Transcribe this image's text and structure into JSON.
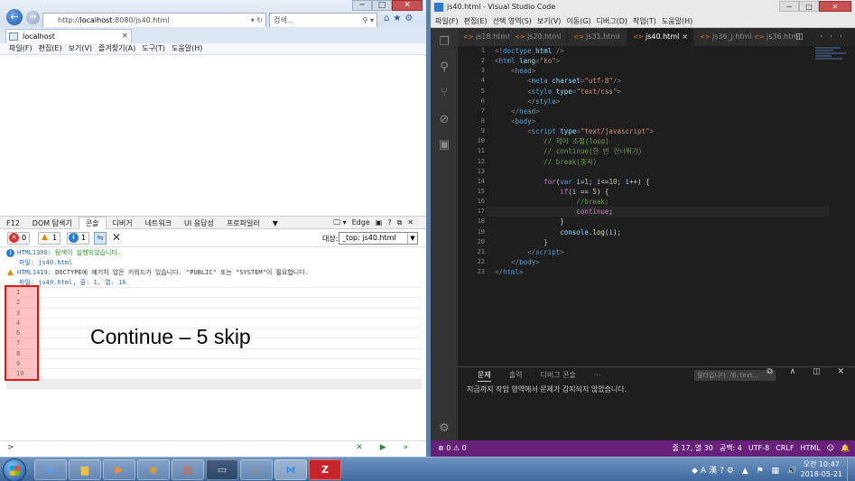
{
  "ie": {
    "address_prefix": "http://",
    "address_host": "localhost",
    "address_rest": ":8080/js40.html",
    "address_icons": "▾ ↻",
    "search_placeholder": "검색...",
    "search_icon": "⚲ ▾",
    "tab_title": "localhost",
    "tab_close": "×",
    "menu": [
      "파일(F)",
      "편집(E)",
      "보기(V)",
      "즐겨찾기(A)",
      "도구(T)",
      "도움말(H)"
    ],
    "toolbar_icons": "⌂★⚙",
    "win_min": "─",
    "win_max": "□",
    "win_close": "✕"
  },
  "devtools": {
    "tabs": [
      "F12",
      "DOM 탐색기",
      "콘솔",
      "디버거",
      "네트워크",
      "UI 응답성",
      "프로파일러",
      "▼"
    ],
    "active_tab": "콘솔",
    "right_controls": [
      "🖵 ▾",
      "Edge",
      "▣",
      "?",
      "⧉",
      "✕"
    ],
    "counts": {
      "errors": "0",
      "warnings": "1",
      "info": "1"
    },
    "target_label": "대상:",
    "target_value": "_top: js40.html",
    "messages": [
      {
        "type": "info",
        "code": "HTML1300:",
        "text": " 탐색이 실행되었습니다.",
        "sub": "파일: js40.html"
      },
      {
        "type": "warning",
        "code": "HTML1419:",
        "text": " DOCTYPE에 예기치 않은 키워드가 있습니다. \"PUBLIC\" 또는 \"SYSTEM\"이 필요합니다.",
        "sub": "파일: js40.html, 줄: 1, 열: 16"
      }
    ],
    "log_values": [
      "1",
      "2",
      "3",
      "4",
      "6",
      "7",
      "8",
      "9",
      "10",
      ""
    ],
    "prompt": ">",
    "run_icons": "✕ ▶ »"
  },
  "annotation": "Continue – 5 skip",
  "vscode": {
    "title": "js40.html - Visual Studio Code",
    "menu": [
      "파일(F)",
      "편집(E)",
      "선택 영역(S)",
      "보기(V)",
      "이동(G)",
      "디버그(D)",
      "작업(T)",
      "도움말(H)"
    ],
    "tabs": [
      "js18.html",
      "js20.html",
      "js31.html",
      "js40.html",
      "js36_j.html",
      "js36.html"
    ],
    "active_tab": "js40.html",
    "tab_close": "×",
    "tab_actions": "◫ ···",
    "panel_tabs": [
      "문제",
      "출력",
      "디버그 콘솔",
      "···"
    ],
    "panel_active": "문제",
    "panel_filter": "필터입니다. 예: text...",
    "panel_icons": "⧉ ∧ ◫ ✕",
    "panel_message": "지금까지 작업 영역에서 문제가 감지되지 않았습니다.",
    "status_left": "⊗ 0 ⚠ 0",
    "status_right": [
      "줄 17, 열 30",
      "공백: 4",
      "UTF-8",
      "CRLF",
      "HTML",
      "☺",
      "🔔"
    ],
    "win_min": "─",
    "win_max": "□",
    "win_close": "✕",
    "activity_icons": [
      "files-icon",
      "search-icon",
      "git-icon",
      "debug-icon",
      "extensions-icon",
      "settings-icon"
    ],
    "code_lines": [
      [
        [
          "d",
          "<!"
        ],
        [
          "t",
          "doctype"
        ],
        [
          "a",
          " html"
        ],
        [
          "d",
          " />"
        ]
      ],
      [
        [
          "d",
          "<"
        ],
        [
          "t",
          "html"
        ],
        [
          "a",
          " lang"
        ],
        [
          "d",
          "="
        ],
        [
          "s",
          "\"ko\""
        ],
        [
          "d",
          ">"
        ]
      ],
      [
        [
          "d",
          "    <"
        ],
        [
          "t",
          "head"
        ],
        [
          "d",
          ">"
        ]
      ],
      [
        [
          "d",
          "        <"
        ],
        [
          "t",
          "meta"
        ],
        [
          "a",
          " charset"
        ],
        [
          "d",
          "="
        ],
        [
          "s",
          "\"utf-8\""
        ],
        [
          "d",
          "/>"
        ]
      ],
      [
        [
          "d",
          "        <"
        ],
        [
          "t",
          "style"
        ],
        [
          "a",
          " type"
        ],
        [
          "d",
          "="
        ],
        [
          "s",
          "\"text/css\""
        ],
        [
          "d",
          ">"
        ]
      ],
      [
        [
          "d",
          "        </"
        ],
        [
          "t",
          "style"
        ],
        [
          "d",
          ">"
        ]
      ],
      [
        [
          "d",
          "    </"
        ],
        [
          "t",
          "head"
        ],
        [
          "d",
          ">"
        ]
      ],
      [
        [
          "d",
          "    <"
        ],
        [
          "t",
          "body"
        ],
        [
          "d",
          ">"
        ]
      ],
      [
        [
          "d",
          "        <"
        ],
        [
          "t",
          "script"
        ],
        [
          "a",
          " type"
        ],
        [
          "d",
          "="
        ],
        [
          "s",
          "\"text/javascript\""
        ],
        [
          "d",
          ">"
        ]
      ],
      [
        [
          "c",
          "            // 제어 조절(loop)"
        ]
      ],
      [
        [
          "c",
          "            // continue(한 번 건너뛰기)"
        ]
      ],
      [
        [
          "c",
          "            // break(중지)"
        ]
      ],
      [
        [
          "p",
          ""
        ]
      ],
      [
        [
          "k",
          "            for"
        ],
        [
          "p",
          "("
        ],
        [
          "t",
          "var"
        ],
        [
          "a",
          " i"
        ],
        [
          "p",
          "="
        ],
        [
          "n",
          "1"
        ],
        [
          "p",
          "; "
        ],
        [
          "a",
          "i"
        ],
        [
          "p",
          "<="
        ],
        [
          "n",
          "10"
        ],
        [
          "p",
          "; "
        ],
        [
          "a",
          "i"
        ],
        [
          "p",
          "++) {"
        ]
      ],
      [
        [
          "k",
          "                if"
        ],
        [
          "p",
          "("
        ],
        [
          "a",
          "i"
        ],
        [
          "p",
          " == "
        ],
        [
          "n",
          "5"
        ],
        [
          "p",
          ") {"
        ]
      ],
      [
        [
          "c",
          "                    //break;"
        ]
      ],
      [
        [
          "k",
          "                    continue"
        ],
        [
          "p",
          ";"
        ]
      ],
      [
        [
          "p",
          "                }"
        ]
      ],
      [
        [
          "a",
          "                console"
        ],
        [
          "p",
          "."
        ],
        [
          "f",
          "log"
        ],
        [
          "p",
          "("
        ],
        [
          "a",
          "i"
        ],
        [
          "p",
          ");"
        ]
      ],
      [
        [
          "p",
          "            }"
        ]
      ],
      [
        [
          "d",
          "        </"
        ],
        [
          "t",
          "script"
        ],
        [
          "d",
          ">"
        ]
      ],
      [
        [
          "d",
          "    </"
        ],
        [
          "t",
          "body"
        ],
        [
          "d",
          ">"
        ]
      ],
      [
        [
          "d",
          "</"
        ],
        [
          "t",
          "html"
        ],
        [
          "d",
          ">"
        ]
      ]
    ]
  },
  "taskbar": {
    "apps": [
      "ie-icon",
      "explorer-icon",
      "media-player-icon",
      "chrome-icon",
      "filezilla-icon",
      "cmd-icon",
      "java-icon",
      "vscode-icon",
      "filezilla-red-icon"
    ],
    "tray_icons": "◆A漢?⚙ ▲ ⚑ ▦ 🔊",
    "time": "오전 10:47",
    "date": "2018-05-21"
  }
}
